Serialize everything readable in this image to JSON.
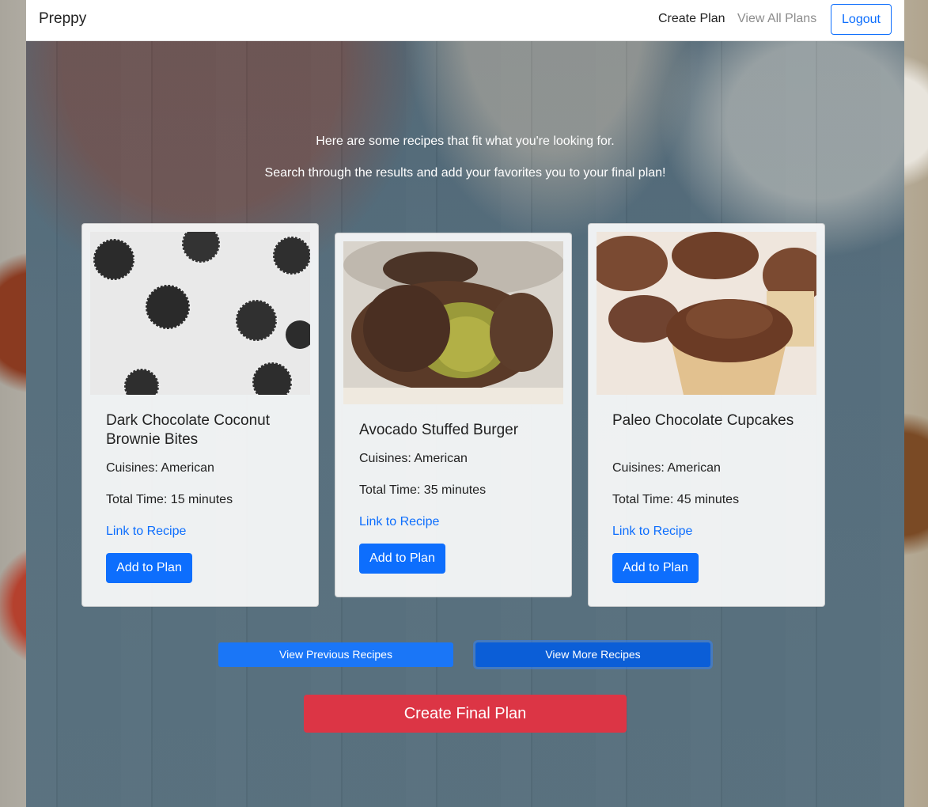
{
  "navbar": {
    "brand": "Preppy",
    "links": [
      {
        "label": "Create Plan",
        "active": true
      },
      {
        "label": "View All Plans",
        "active": false
      }
    ],
    "logout_label": "Logout"
  },
  "intro": {
    "line1": "Here are some recipes that fit what you're looking for.",
    "line2": "Search through the results and add your favorites you to your final plan!"
  },
  "recipes": [
    {
      "title": "Dark Chocolate Coconut Brownie Bites",
      "cuisines": "Cuisines: American",
      "total_time": "Total Time: 15 minutes",
      "link_label": "Link to Recipe",
      "add_label": "Add to Plan",
      "image": "coconut-brownie-bites-photo"
    },
    {
      "title": "Avocado Stuffed Burger",
      "cuisines": "Cuisines: American",
      "total_time": "Total Time: 35 minutes",
      "link_label": "Link to Recipe",
      "add_label": "Add to Plan",
      "image": "stuffed-burger-photo"
    },
    {
      "title": "Paleo Chocolate Cupcakes",
      "cuisines": "Cuisines: American",
      "total_time": "Total Time: 45 minutes",
      "link_label": "Link to Recipe",
      "add_label": "Add to Plan",
      "image": "chocolate-cupcakes-photo"
    }
  ],
  "pager": {
    "prev_label": "View Previous Recipes",
    "next_label": "View More Recipes"
  },
  "final_label": "Create Final Plan",
  "colors": {
    "primary": "#0d6efd",
    "danger": "#dc3545",
    "overlay": "#536b7a"
  }
}
